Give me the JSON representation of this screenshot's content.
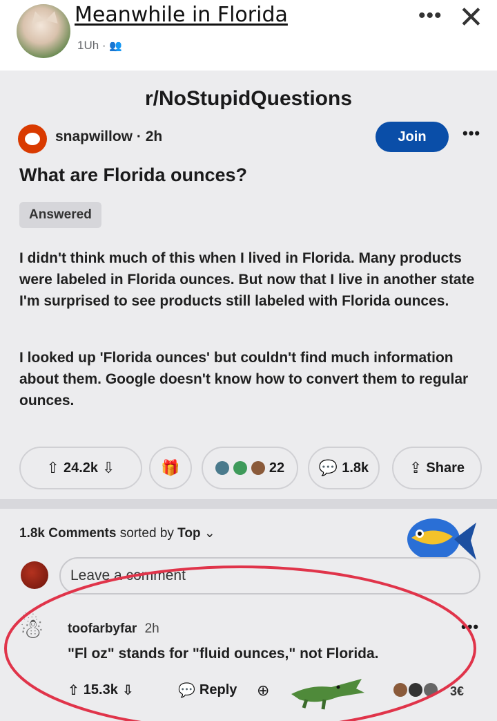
{
  "facebook": {
    "page_name": "Meanwhile in Florida",
    "time": "1Uh",
    "audience_icon": "friends-icon",
    "more_label": "•••",
    "close_label": "✕"
  },
  "post": {
    "subreddit": "r/NoStupidQuestions",
    "author": "snapwillow",
    "age": "2h",
    "join_label": "Join",
    "more_label": "•••",
    "title": "What are Florida ounces?",
    "flair": "Answered",
    "paragraph1": "I didn't think much of this when I lived in Florida. Many products were labeled in Florida ounces. But now that I live in another state I'm surprised to see products still labeled with Florida ounces.",
    "paragraph2": "I looked up 'Florida ounces' but couldn't find much information about them. Google doesn't know how to convert them to regular ounces.",
    "votes": "24.2k",
    "awards_count": "22",
    "comments_count": "1.8k",
    "share_label": "Share"
  },
  "comments_section": {
    "count_label": "1.8k Comments",
    "sorted_by": "sorted by",
    "sort_value": "Top",
    "input_placeholder": "Leave a comment"
  },
  "top_comment": {
    "author": "toofarbyfar",
    "age": "2h",
    "more_label": "•••",
    "text": "\"Fl oz\" stands for \"fluid ounces,\" not Florida.",
    "votes": "15.3k",
    "reply_label": "Reply",
    "award_count": "3€"
  },
  "colors": {
    "join_button": "#0a4ea8",
    "reddit_orange": "#d93a00",
    "annotation_circle": "#e0344a"
  }
}
